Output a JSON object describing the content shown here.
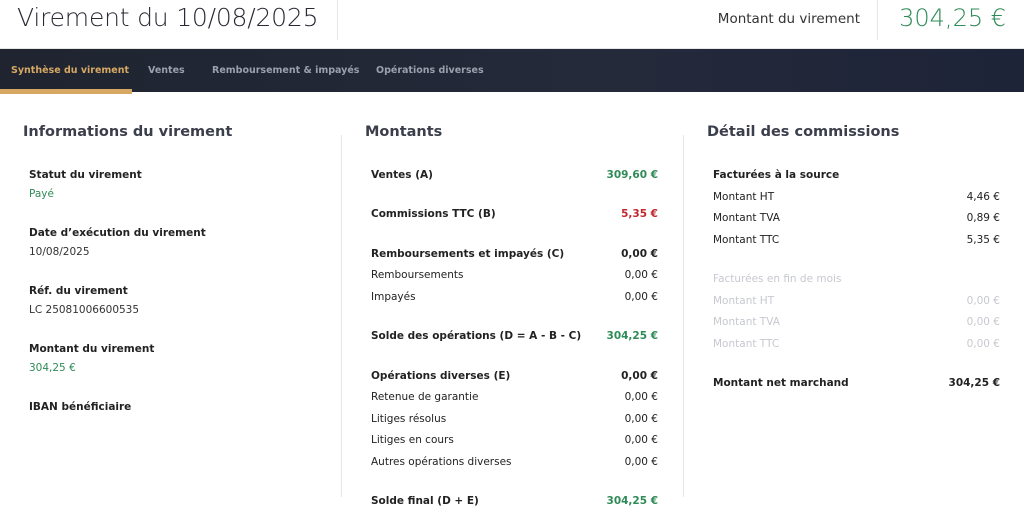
{
  "header": {
    "title": "Virement du 10/08/2025",
    "amount_label": "Montant du virement",
    "amount_value": "304,25 €"
  },
  "nav": {
    "tabs": [
      {
        "label": "Synthèse du virement",
        "active": true
      },
      {
        "label": "Ventes",
        "active": false
      },
      {
        "label": "Remboursement & impayés",
        "active": false
      },
      {
        "label": "Opérations diverses",
        "active": false
      }
    ]
  },
  "info": {
    "title": "Informations du virement",
    "status_label": "Statut du virement",
    "status_value": "Payé",
    "date_label": "Date d’exécution du virement",
    "date_value": "10/08/2025",
    "ref_label": "Réf. du virement",
    "ref_value": "LC 25081006600535",
    "amount_label": "Montant du virement",
    "amount_value": "304,25 €",
    "iban_label": "IBAN bénéficiaire"
  },
  "montants": {
    "title": "Montants",
    "rows": [
      {
        "label": "Ventes (A)",
        "value": "309,60 €"
      },
      {
        "label": "Commissions TTC (B)",
        "value": "5,35 €"
      },
      {
        "label": "Remboursements et impayés (C)",
        "value": "0,00 €"
      },
      {
        "label": "Remboursements",
        "value": "0,00 €"
      },
      {
        "label": "Impayés",
        "value": "0,00 €"
      },
      {
        "label": "Solde des opérations (D = A - B - C)",
        "value": "304,25 €"
      },
      {
        "label": "Opérations diverses (E)",
        "value": "0,00 €"
      },
      {
        "label": "Retenue de garantie",
        "value": "0,00 €"
      },
      {
        "label": "Litiges résolus",
        "value": "0,00 €"
      },
      {
        "label": "Litiges en cours",
        "value": "0,00 €"
      },
      {
        "label": "Autres opérations diverses",
        "value": "0,00 €"
      },
      {
        "label": "Solde final (D + E)",
        "value": "304,25 €"
      }
    ]
  },
  "commissions": {
    "title": "Détail des commissions",
    "source_title": "Facturées à la source",
    "source_rows": [
      {
        "label": "Montant HT",
        "value": "4,46 €"
      },
      {
        "label": "Montant TVA",
        "value": "0,89 €"
      },
      {
        "label": "Montant TTC",
        "value": "5,35 €"
      }
    ],
    "month_title": "Facturées en fin de mois",
    "month_rows": [
      {
        "label": "Montant HT",
        "value": "0,00 €"
      },
      {
        "label": "Montant TVA",
        "value": "0,00 €"
      },
      {
        "label": "Montant TTC",
        "value": "0,00 €"
      }
    ],
    "net_label": "Montant net marchand",
    "net_value": "304,25 €"
  },
  "colors": {
    "green": "#2e8b57",
    "red": "#c0282d",
    "accent": "#d7a863",
    "nav_bg": "#1f2430"
  }
}
